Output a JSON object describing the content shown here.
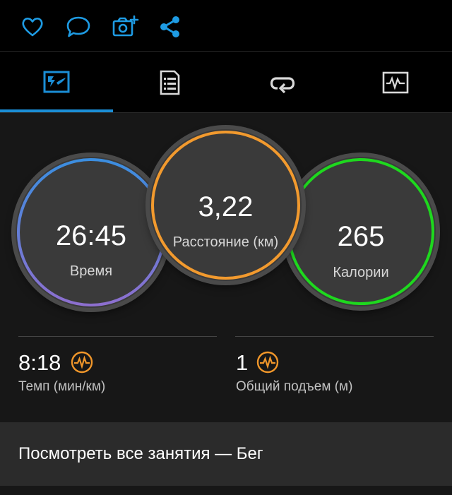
{
  "toolbar": {
    "icons": [
      "heart-icon",
      "comment-icon",
      "add-photo-icon",
      "share-icon"
    ],
    "accent": "#1e9be3"
  },
  "tabs": {
    "items": [
      "summary-tab",
      "details-tab",
      "laps-tab",
      "charts-tab"
    ],
    "active": 0,
    "accent": "#1b8ed6"
  },
  "circles": {
    "time": {
      "value": "26:45",
      "label": "Время",
      "colors": [
        "#3b8ee0",
        "#8d6fcf"
      ]
    },
    "distance": {
      "value": "3,22",
      "label": "Расстояние (км)",
      "color": "#f29a2e"
    },
    "calories": {
      "value": "265",
      "label": "Калории",
      "color": "#1ed81e"
    }
  },
  "stats": {
    "pace": {
      "value": "8:18",
      "label": "Темп (мин/км)"
    },
    "elevation": {
      "value": "1",
      "label": "Общий подъем (м)"
    },
    "accent": "#f0962a"
  },
  "footer": {
    "label": "Посмотреть все занятия — Бег"
  }
}
